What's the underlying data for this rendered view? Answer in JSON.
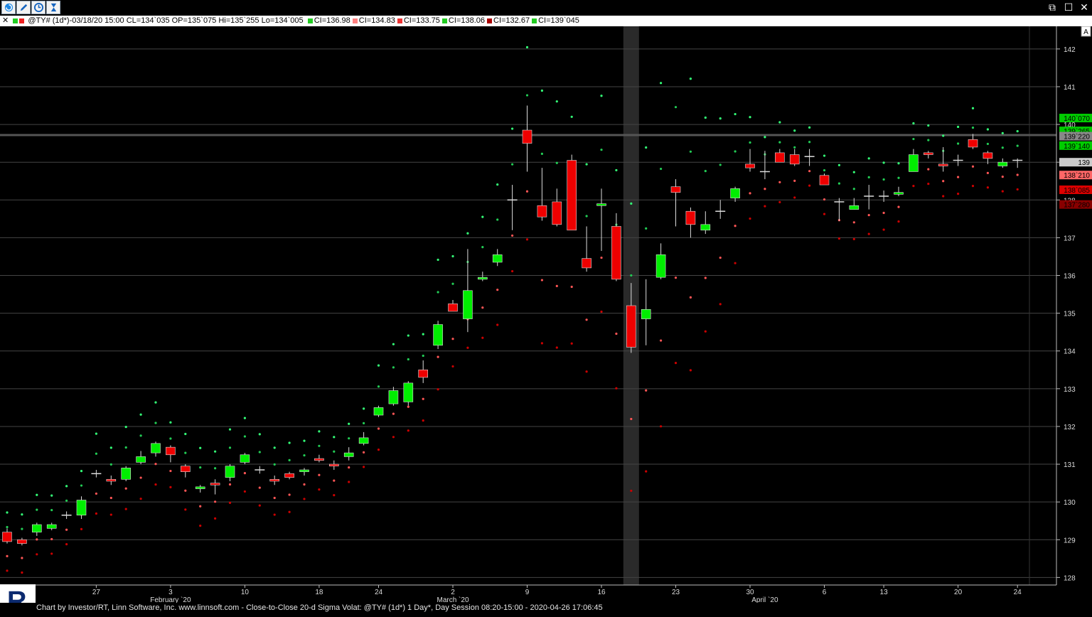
{
  "toolbar": {
    "icons": [
      "refresh-icon",
      "pencil-icon",
      "clock-icon",
      "hourglass-icon"
    ],
    "window_controls": [
      "restore-icon",
      "maximize-icon",
      "close-icon"
    ]
  },
  "info_bar": {
    "bar_info": "@TY# (1d*)-03/18/20 15:00 CL=134`035 OP=135`075 Hi=135`255 Lo=134`005",
    "ci_items": [
      {
        "text": "CI=136.98",
        "color": "#22cc22"
      },
      {
        "text": "CI=134.83",
        "color": "#ff8080"
      },
      {
        "text": "CI=133.75",
        "color": "#ee3333"
      },
      {
        "text": "CI=138.06",
        "color": "#22cc22"
      },
      {
        "text": "CI=132.67",
        "color": "#aa0000"
      },
      {
        "text": "CI=139`045",
        "color": "#22cc22"
      }
    ]
  },
  "footer": {
    "text": "Chart by Investor/RT, Linn Software, Inc. www.linnsoft.com - Close-to-Close 20-d Sigma Volat: @TY# (1d*) 1 Day*, Day Session 08:20-15:00 - 2020-04-26 17:06:45"
  },
  "chart_data": {
    "type": "candlestick",
    "symbol": "@TY#",
    "interval": "1d",
    "colors": {
      "up": "#00ee00",
      "down": "#ee0000",
      "doji": "#dddddd",
      "grid": "#444444",
      "band_outer_up": "#33ff77",
      "band_inner_up": "#22cc55",
      "band_inner_dn": "#ff5555",
      "band_outer_dn": "#cc0000"
    },
    "ylim": [
      127.8,
      142.6
    ],
    "y_ticks": [
      128,
      129,
      130,
      131,
      132,
      133,
      134,
      135,
      136,
      137,
      138,
      139,
      140,
      141,
      142
    ],
    "x_ticks": [
      {
        "label": "27",
        "index": 6
      },
      {
        "label": "3",
        "index": 11
      },
      {
        "label": "10",
        "index": 16
      },
      {
        "label": "18",
        "index": 21
      },
      {
        "label": "24",
        "index": 25
      },
      {
        "label": "2",
        "index": 30
      },
      {
        "label": "9",
        "index": 35
      },
      {
        "label": "16",
        "index": 40
      },
      {
        "label": "23",
        "index": 45
      },
      {
        "label": "30",
        "index": 50
      },
      {
        "label": "6",
        "index": 55
      },
      {
        "label": "13",
        "index": 59
      },
      {
        "label": "20",
        "index": 64
      },
      {
        "label": "24",
        "index": 68
      }
    ],
    "month_labels": [
      {
        "label": "February `20",
        "index": 11
      },
      {
        "label": "March `20",
        "index": 30
      },
      {
        "label": "April `20",
        "index": 51
      }
    ],
    "highlight_index": 42,
    "price_labels": [
      {
        "text": "140`070",
        "value": 140.17,
        "color": "#00cc00"
      },
      {
        "text": "139`265",
        "value": 139.83,
        "color": "#00cc00"
      },
      {
        "text": "139`220",
        "value": 139.69,
        "color": "#888888"
      },
      {
        "text": "139`140",
        "value": 139.44,
        "color": "#00cc00"
      },
      {
        "text": "139",
        "value": 139.0,
        "color": "#cccccc"
      },
      {
        "text": "138`210",
        "value": 138.66,
        "color": "#ff6666"
      },
      {
        "text": "138`085",
        "value": 138.27,
        "color": "#dd0000"
      },
      {
        "text": "137`280",
        "value": 137.88,
        "color": "#880000"
      }
    ],
    "candles": [
      {
        "o": 129.2,
        "h": 129.3,
        "l": 128.9,
        "c": 128.95
      },
      {
        "o": 129.0,
        "h": 129.05,
        "l": 128.85,
        "c": 128.9
      },
      {
        "o": 129.2,
        "h": 129.45,
        "l": 129.1,
        "c": 129.4
      },
      {
        "o": 129.3,
        "h": 129.45,
        "l": 129.25,
        "c": 129.4
      },
      {
        "o": 129.65,
        "h": 129.75,
        "l": 129.55,
        "c": 129.65
      },
      {
        "o": 129.65,
        "h": 130.15,
        "l": 129.55,
        "c": 130.05
      },
      {
        "o": 130.75,
        "h": 130.85,
        "l": 130.65,
        "c": 130.75
      },
      {
        "o": 130.6,
        "h": 130.7,
        "l": 130.45,
        "c": 130.55
      },
      {
        "o": 130.6,
        "h": 130.95,
        "l": 130.55,
        "c": 130.9
      },
      {
        "o": 131.05,
        "h": 131.35,
        "l": 131.0,
        "c": 131.2
      },
      {
        "o": 131.3,
        "h": 131.6,
        "l": 131.2,
        "c": 131.55
      },
      {
        "o": 131.45,
        "h": 131.5,
        "l": 131.05,
        "c": 131.25
      },
      {
        "o": 130.95,
        "h": 131.0,
        "l": 130.65,
        "c": 130.8
      },
      {
        "o": 130.35,
        "h": 130.45,
        "l": 130.25,
        "c": 130.4
      },
      {
        "o": 130.5,
        "h": 130.6,
        "l": 130.2,
        "c": 130.45
      },
      {
        "o": 130.65,
        "h": 131.0,
        "l": 130.55,
        "c": 130.95
      },
      {
        "o": 131.05,
        "h": 131.3,
        "l": 131.0,
        "c": 131.25
      },
      {
        "o": 130.85,
        "h": 130.95,
        "l": 130.75,
        "c": 130.85
      },
      {
        "o": 130.6,
        "h": 130.7,
        "l": 130.45,
        "c": 130.55
      },
      {
        "o": 130.75,
        "h": 130.8,
        "l": 130.6,
        "c": 130.65
      },
      {
        "o": 130.8,
        "h": 130.9,
        "l": 130.7,
        "c": 130.85
      },
      {
        "o": 131.15,
        "h": 131.25,
        "l": 131.05,
        "c": 131.1
      },
      {
        "o": 131.0,
        "h": 131.1,
        "l": 130.85,
        "c": 130.95
      },
      {
        "o": 131.2,
        "h": 131.45,
        "l": 131.1,
        "c": 131.3
      },
      {
        "o": 131.55,
        "h": 131.85,
        "l": 131.5,
        "c": 131.7
      },
      {
        "o": 132.3,
        "h": 132.55,
        "l": 132.25,
        "c": 132.5
      },
      {
        "o": 132.6,
        "h": 133.05,
        "l": 132.55,
        "c": 132.95
      },
      {
        "o": 132.65,
        "h": 133.2,
        "l": 132.55,
        "c": 133.15
      },
      {
        "o": 133.5,
        "h": 133.75,
        "l": 133.15,
        "c": 133.3
      },
      {
        "o": 134.15,
        "h": 134.8,
        "l": 134.05,
        "c": 134.7
      },
      {
        "o": 135.25,
        "h": 135.35,
        "l": 135.05,
        "c": 135.05
      },
      {
        "o": 134.85,
        "h": 136.7,
        "l": 134.5,
        "c": 135.6
      },
      {
        "o": 135.9,
        "h": 136.1,
        "l": 135.85,
        "c": 135.95
      },
      {
        "o": 136.35,
        "h": 136.7,
        "l": 136.25,
        "c": 136.55
      },
      {
        "o": 138.0,
        "h": 138.4,
        "l": 137.2,
        "c": 138.0
      },
      {
        "o": 139.85,
        "h": 140.5,
        "l": 138.75,
        "c": 139.5
      },
      {
        "o": 137.85,
        "h": 138.85,
        "l": 137.45,
        "c": 137.55
      },
      {
        "o": 137.95,
        "h": 138.3,
        "l": 137.3,
        "c": 137.35
      },
      {
        "o": 139.05,
        "h": 139.2,
        "l": 137.2,
        "c": 137.2
      },
      {
        "o": 136.45,
        "h": 137.3,
        "l": 136.1,
        "c": 136.2
      },
      {
        "o": 137.85,
        "h": 138.3,
        "l": 136.65,
        "c": 137.9
      },
      {
        "o": 137.3,
        "h": 137.65,
        "l": 135.85,
        "c": 135.9
      },
      {
        "o": 135.2,
        "h": 135.8,
        "l": 133.95,
        "c": 134.1
      },
      {
        "o": 134.85,
        "h": 135.9,
        "l": 134.15,
        "c": 135.1
      },
      {
        "o": 135.95,
        "h": 136.85,
        "l": 135.9,
        "c": 136.55
      },
      {
        "o": 138.35,
        "h": 138.55,
        "l": 137.3,
        "c": 138.2
      },
      {
        "o": 137.7,
        "h": 137.8,
        "l": 137.0,
        "c": 137.35
      },
      {
        "o": 137.2,
        "h": 137.7,
        "l": 137.1,
        "c": 137.35
      },
      {
        "o": 137.7,
        "h": 138.0,
        "l": 137.5,
        "c": 137.7
      },
      {
        "o": 138.05,
        "h": 138.35,
        "l": 137.95,
        "c": 138.3
      },
      {
        "o": 138.95,
        "h": 139.35,
        "l": 138.75,
        "c": 138.85
      },
      {
        "o": 138.75,
        "h": 139.3,
        "l": 138.55,
        "c": 138.75
      },
      {
        "o": 139.25,
        "h": 139.35,
        "l": 139.0,
        "c": 139.0
      },
      {
        "o": 139.2,
        "h": 139.35,
        "l": 138.9,
        "c": 138.95
      },
      {
        "o": 139.15,
        "h": 139.35,
        "l": 138.9,
        "c": 139.15
      },
      {
        "o": 138.65,
        "h": 138.7,
        "l": 138.4,
        "c": 138.4
      },
      {
        "o": 137.95,
        "h": 138.05,
        "l": 137.45,
        "c": 137.95
      },
      {
        "o": 137.75,
        "h": 138.05,
        "l": 137.75,
        "c": 137.85
      },
      {
        "o": 138.1,
        "h": 138.4,
        "l": 137.75,
        "c": 138.1
      },
      {
        "o": 138.1,
        "h": 138.25,
        "l": 137.95,
        "c": 138.1
      },
      {
        "o": 138.15,
        "h": 138.35,
        "l": 138.1,
        "c": 138.2
      },
      {
        "o": 138.75,
        "h": 139.35,
        "l": 138.75,
        "c": 139.2
      },
      {
        "o": 139.25,
        "h": 139.3,
        "l": 139.1,
        "c": 139.2
      },
      {
        "o": 138.95,
        "h": 139.4,
        "l": 138.75,
        "c": 138.9
      },
      {
        "o": 139.05,
        "h": 139.2,
        "l": 138.9,
        "c": 139.05
      },
      {
        "o": 139.6,
        "h": 139.75,
        "l": 139.35,
        "c": 139.4
      },
      {
        "o": 139.25,
        "h": 139.3,
        "l": 138.95,
        "c": 139.1
      },
      {
        "o": 138.9,
        "h": 139.1,
        "l": 138.85,
        "c": 139.0
      },
      {
        "o": 139.05,
        "h": 139.1,
        "l": 138.85,
        "c": 139.05
      }
    ]
  }
}
